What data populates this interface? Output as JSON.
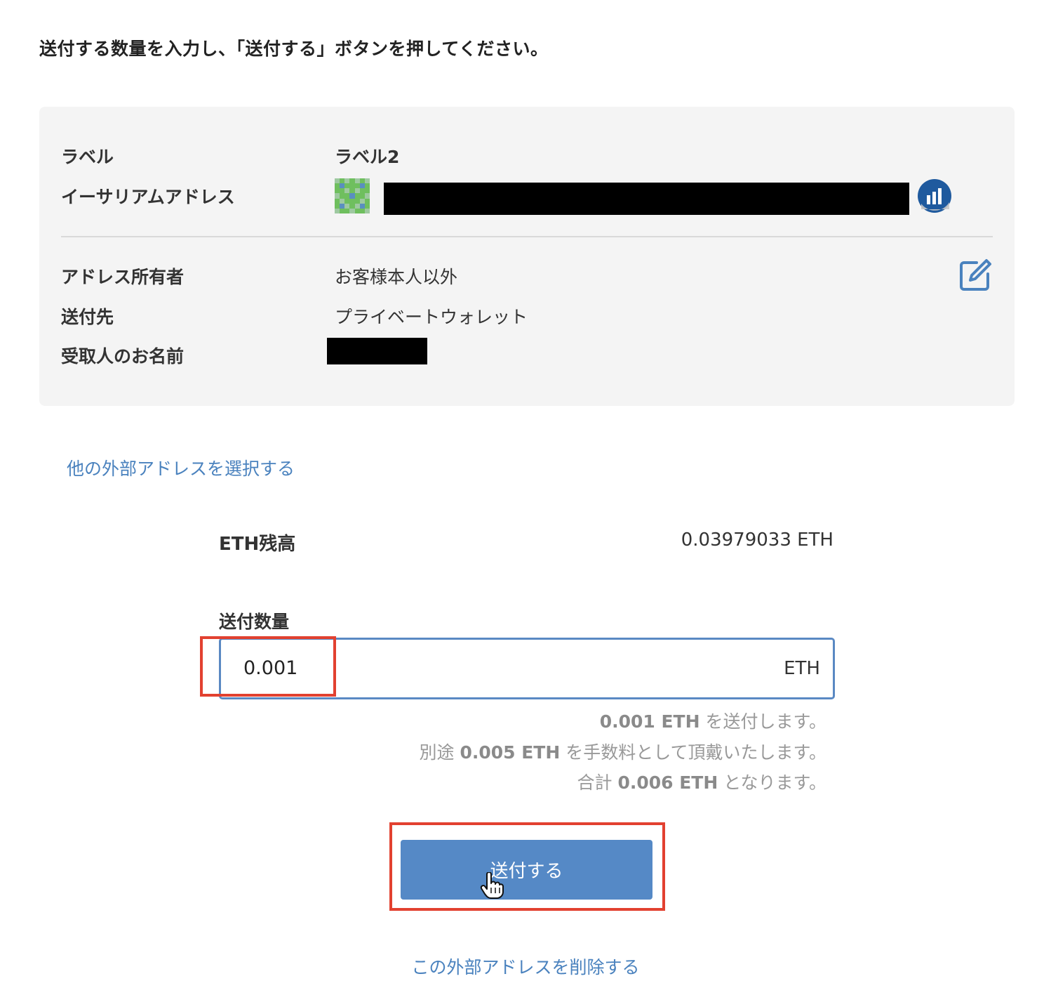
{
  "instruction": "送付する数量を入力し、「送付する」ボタンを押してください。",
  "details": {
    "label_key": "ラベル",
    "label_value": "ラベル2",
    "address_key": "イーサリアムアドレス",
    "owner_key": "アドレス所有者",
    "owner_value": "お客様本人以外",
    "destination_key": "送付先",
    "destination_value": "プライベートウォレット",
    "recipient_key": "受取人のお名前"
  },
  "select_other_link": "他の外部アドレスを選択する",
  "balance": {
    "label": "ETH残高",
    "value": "0.03979033 ETH"
  },
  "amount": {
    "label": "送付数量",
    "value": "0.001",
    "unit": "ETH"
  },
  "notes": {
    "line1_amount": "0.001 ETH",
    "line1_suffix": " を送付します。",
    "line2_prefix": "別途 ",
    "line2_fee": "0.005 ETH",
    "line2_suffix": " を手数料として頂戴いたします。",
    "line3_prefix": "合計 ",
    "line3_total": "0.006 ETH",
    "line3_suffix": " となります。"
  },
  "send_button": "送付する",
  "delete_link": "この外部アドレスを削除する",
  "icons": {
    "avatar": "identicon-avatar-icon",
    "chart": "chart-icon",
    "edit": "edit-icon",
    "cursor": "hand-pointer-icon"
  },
  "colors": {
    "accent": "#5589c6",
    "link": "#4a82be",
    "highlight": "#e24130",
    "panel_bg": "#f4f4f4"
  }
}
